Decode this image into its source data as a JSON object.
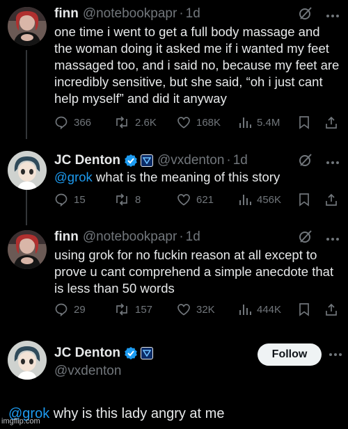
{
  "tweets": [
    {
      "name": "finn",
      "handle": "@notebookpapr",
      "time": "1d",
      "text": "one time i went to get a full body massage and the woman doing it asked me if i wanted my feet massaged too, and i said no, because my feet are incredibly sensitive, but she said, “oh i just cant help myself” and did it anyway",
      "replies": "366",
      "reposts": "2.6K",
      "likes": "168K",
      "views": "5.4M"
    },
    {
      "name": "JC Denton",
      "handle": "@vxdenton",
      "time": "1d",
      "mention": "@grok",
      "text": "what is the meaning of this story",
      "replies": "15",
      "reposts": "8",
      "likes": "621",
      "views": "456K"
    },
    {
      "name": "finn",
      "handle": "@notebookpapr",
      "time": "1d",
      "text": "using grok for no fuckin reason at all except to prove u cant comprehend a simple anecdote that is less than 50 words",
      "replies": "29",
      "reposts": "157",
      "likes": "32K",
      "views": "444K"
    }
  ],
  "main_tweet": {
    "name": "JC Denton",
    "handle": "@vxdenton",
    "follow_label": "Follow",
    "mention": "@grok",
    "text": "why is this lady angry at me"
  },
  "separator": "·",
  "watermark": "imgflip.com",
  "colors": {
    "accent": "#1d9bf0",
    "muted": "#71767b",
    "background": "#000000",
    "text": "#e7e9ea"
  },
  "icons": [
    "grok-icon",
    "more-icon",
    "reply-icon",
    "repost-icon",
    "like-icon",
    "views-icon",
    "bookmark-icon",
    "share-icon",
    "verified-badge-icon",
    "org-badge-icon"
  ]
}
